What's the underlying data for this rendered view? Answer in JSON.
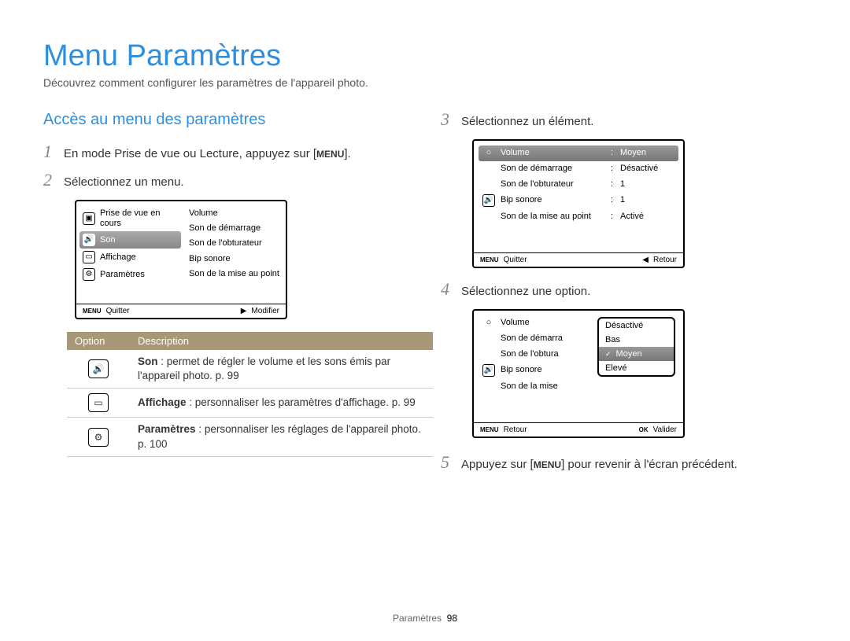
{
  "page": {
    "title": "Menu Paramètres",
    "intro": "Découvrez comment configurer les paramètres de l'appareil photo.",
    "footer_label": "Paramètres",
    "footer_page": "98"
  },
  "left": {
    "section_heading": "Accès au menu des paramètres",
    "step1_pre": "En mode Prise de vue ou Lecture, appuyez sur [",
    "step1_btn": "MENU",
    "step1_post": "].",
    "step2": "Sélectionnez un menu.",
    "lcd2": {
      "left_items": {
        "capture": "Prise de vue en cours",
        "sound": "Son",
        "display": "Affichage",
        "settings": "Paramètres"
      },
      "right_items": {
        "volume": "Volume",
        "start_sound": "Son de démarrage",
        "shutter_sound": "Son de l'obturateur",
        "beep": "Bip sonore",
        "af_sound": "Son de la mise au point"
      },
      "footer_left_icon": "MENU",
      "footer_left": "Quitter",
      "footer_right": "Modifier"
    },
    "table": {
      "h_option": "Option",
      "h_desc": "Description",
      "row_sound_strong": "Son",
      "row_sound_rest": " : permet de régler le volume et les sons émis par l'appareil photo. p. 99",
      "row_display_strong": "Affichage",
      "row_display_rest": " : personnaliser les paramètres d'affichage. p. 99",
      "row_settings_strong": "Paramètres",
      "row_settings_rest": " : personnaliser les réglages de l'appareil photo. p. 100"
    }
  },
  "right": {
    "step3": "Sélectionnez un élément.",
    "lcd3": {
      "items": {
        "volume_label": "Volume",
        "volume_val": "Moyen",
        "start_label": "Son de démarrage",
        "start_val": "Désactivé",
        "shutter_label": "Son de l'obturateur",
        "shutter_val": "1",
        "beep_label": "Bip sonore",
        "beep_val": "1",
        "af_label": "Son de la mise au point",
        "af_val": "Activé"
      },
      "footer_left_icon": "MENU",
      "footer_left": "Quitter",
      "footer_right": "Retour"
    },
    "step4": "Sélectionnez une option.",
    "lcd4": {
      "items": {
        "volume": "Volume",
        "start": "Son de démarra",
        "shutter": "Son de l'obtura",
        "beep": "Bip sonore",
        "af": "Son de la mise"
      },
      "popup": {
        "off": "Désactivé",
        "low": "Bas",
        "mid": "Moyen",
        "high": "Elevé"
      },
      "footer_left_icon": "MENU",
      "footer_left": "Retour",
      "footer_right_icon": "OK",
      "footer_right": "Valider"
    },
    "step5_pre": "Appuyez sur [",
    "step5_btn": "MENU",
    "step5_post": "] pour revenir à l'écran précédent."
  }
}
